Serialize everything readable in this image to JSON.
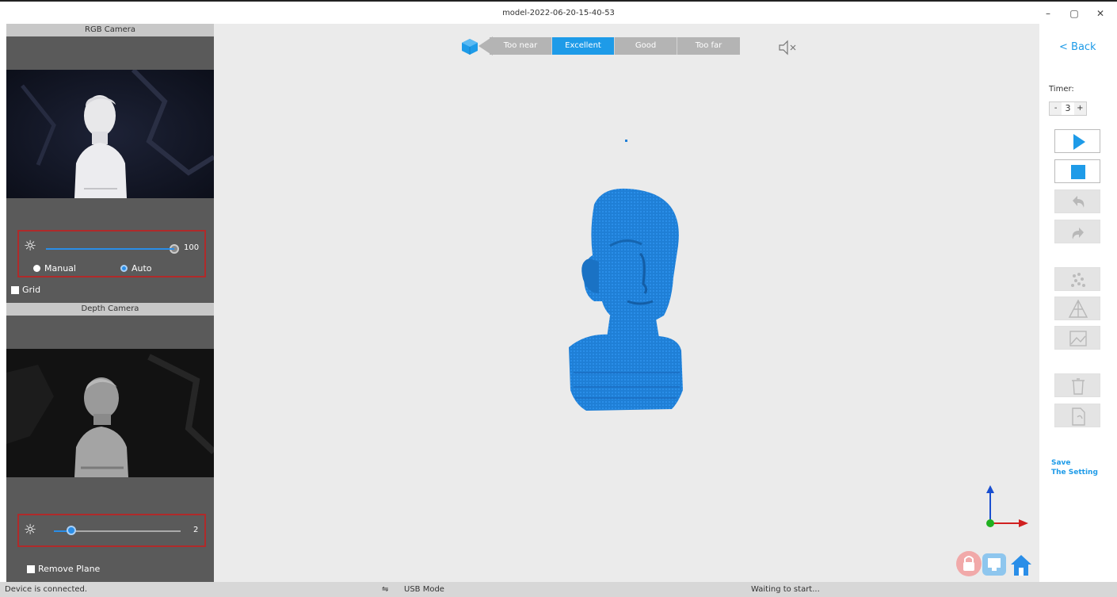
{
  "window": {
    "title": "model-2022-06-20-15-40-53",
    "minimize": "–",
    "maximize": "▢",
    "close": "✕"
  },
  "rgb_camera": {
    "title": "RGB Camera",
    "brightness_value": "100",
    "brightness_level": 1.0,
    "mode_manual": "Manual",
    "mode_auto": "Auto",
    "selected_mode": "Auto",
    "grid_label": "Grid"
  },
  "depth_camera": {
    "title": "Depth Camera",
    "exposure_value": "2",
    "exposure_level": 0.14,
    "remove_plane_label": "Remove Plane"
  },
  "distance_indicator": {
    "segments": [
      "Too near",
      "Excellent",
      "Good",
      "Too far"
    ],
    "active": "Excellent"
  },
  "sidebar": {
    "back": "< Back",
    "timer_label": "Timer:",
    "timer_minus": "-",
    "timer_value": "3",
    "timer_plus": "+",
    "save_setting_line1": "Save",
    "save_setting_line2": "The Setting"
  },
  "status": {
    "left": "Device is connected.",
    "mode": "USB Mode",
    "right": "Waiting to start..."
  },
  "colors": {
    "accent": "#1e9be8",
    "model": "#1f7fd6",
    "highlight_border": "#b02a2a"
  }
}
